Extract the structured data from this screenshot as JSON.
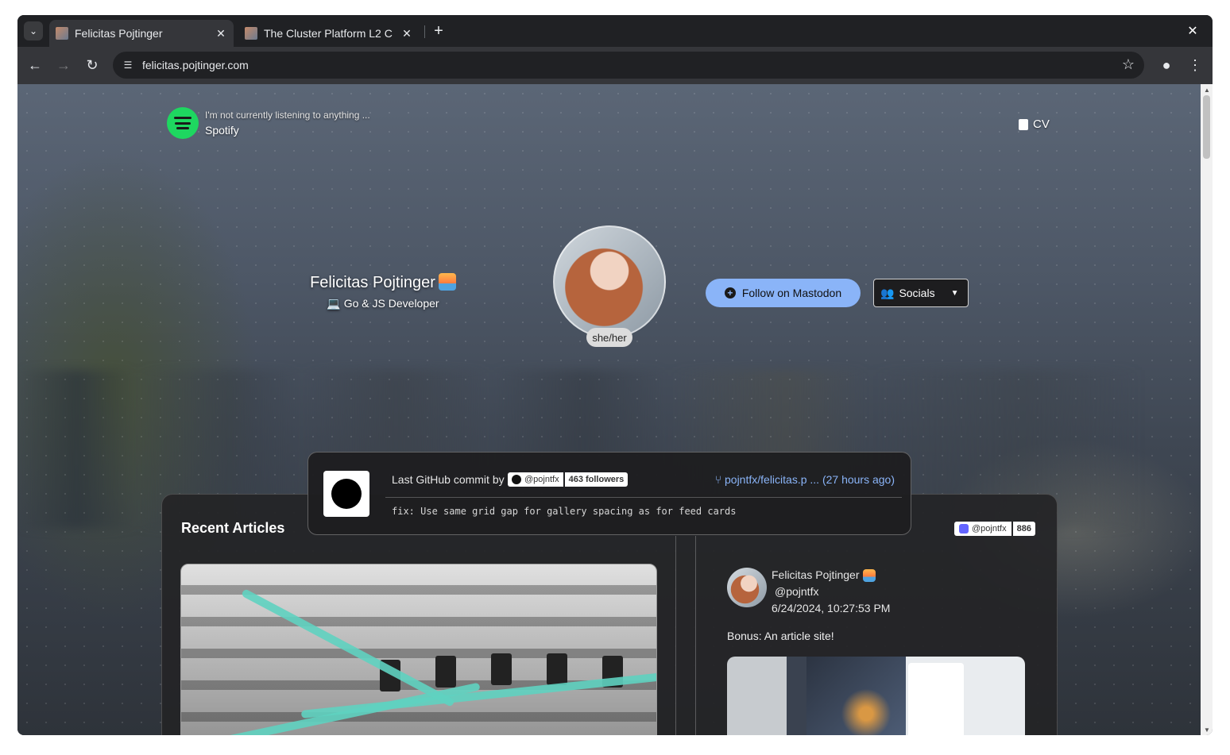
{
  "browser": {
    "tabs": [
      {
        "title": "Felicitas Pojtinger",
        "active": true
      },
      {
        "title": "The Cluster Platform L2 C",
        "active": false
      }
    ],
    "url": "felicitas.pojtinger.com"
  },
  "page": {
    "spotify": {
      "status": "I'm not currently listening to anything ...",
      "service": "Spotify",
      "color": "#1ed760"
    },
    "cv_label": "CV",
    "profile": {
      "name": "Felicitas Pojtinger",
      "role": "💻 Go & JS Developer",
      "pronouns": "she/her"
    },
    "follow_button": "Follow on Mastodon",
    "socials_button": "Socials",
    "accent_color": "#8ab4f8",
    "commit": {
      "label": "Last GitHub commit by",
      "user": "@pojntfx",
      "followers": "463 followers",
      "repo": "pojntfx/felicitas.p ... (27 hours ago)",
      "message": "fix: Use same grid gap for gallery spacing as for feed cards"
    },
    "articles": {
      "title": "Recent Articles"
    },
    "mastodon": {
      "handle": "@pojntfx",
      "count": "886",
      "post": {
        "author": "Felicitas Pojtinger",
        "handle": "@pojntfx",
        "timestamp": "6/24/2024, 10:27:53 PM",
        "text": "Bonus: An article site!"
      }
    }
  }
}
